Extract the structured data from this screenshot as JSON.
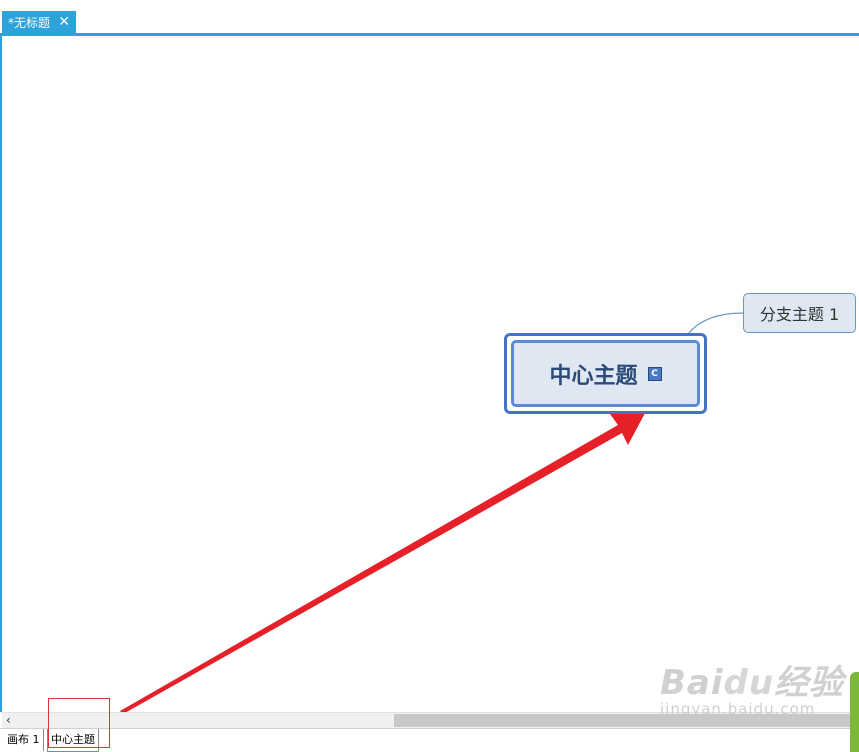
{
  "tab": {
    "title": "*无标题",
    "close_glyph": "✕"
  },
  "mindmap": {
    "central_topic": "中心主题",
    "central_icon_letter": "C",
    "branch_topic": "分支主题 1"
  },
  "scrollbar": {
    "left_arrow": "‹"
  },
  "sheets": [
    {
      "label": "画布 1"
    },
    {
      "label": "中心主题"
    }
  ],
  "watermark": {
    "logo_text_a": "Bai",
    "logo_text_b": "du",
    "logo_suffix": "经验",
    "site": "jingyan.baidu.com"
  },
  "colors": {
    "accent": "#2ea3d9",
    "topic_border": "#4472c4",
    "topic_fill": "#dfe7f3",
    "topic_text": "#2c4a78",
    "annotation_red": "#e63232"
  }
}
